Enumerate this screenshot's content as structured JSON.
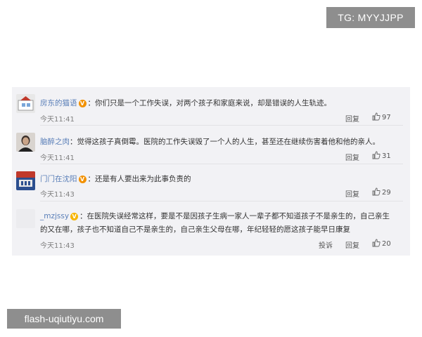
{
  "watermarks": {
    "top_right": "TG: MYYJJPP",
    "bottom_left": "flash-uqiutiyu.com"
  },
  "colors": {
    "username": "#5a7fb8",
    "panel_bg": "#f2f2f5",
    "vip_badge": "#f29100"
  },
  "comments": [
    {
      "username": "房东的猫语",
      "badge": "V",
      "text": "：你们只是一个工作失误，对两个孩子和家庭来说，却是错误的人生轨迹。",
      "time": "今天11:41",
      "reply": "回复",
      "likes": "97"
    },
    {
      "username": "脑醉之肉",
      "badge": "",
      "text": "：觉得这孩子真倒霉。医院的工作失误毁了一个人的人生，甚至还在继续伤害着他和他的亲人。",
      "time": "今天11:41",
      "reply": "回复",
      "likes": "31"
    },
    {
      "username": "门门在沈阳",
      "badge": "V",
      "text": "：还是有人要出来为此事负责的",
      "time": "今天11:43",
      "reply": "回复",
      "likes": "29"
    },
    {
      "username": "_mzjssy",
      "badge": "V",
      "text": "：在医院失误经常这样，要是不是因孩子生病一家人一辈子都不知道孩子不是亲生的，自己亲生",
      "text2": "的又在哪，孩子也不知道自己不是亲生的，自己亲生父母在哪，年纪轻轻的愿这孩子能早日康复",
      "time": "今天11:43",
      "report": "投诉",
      "reply": "回复",
      "likes": "20"
    }
  ]
}
